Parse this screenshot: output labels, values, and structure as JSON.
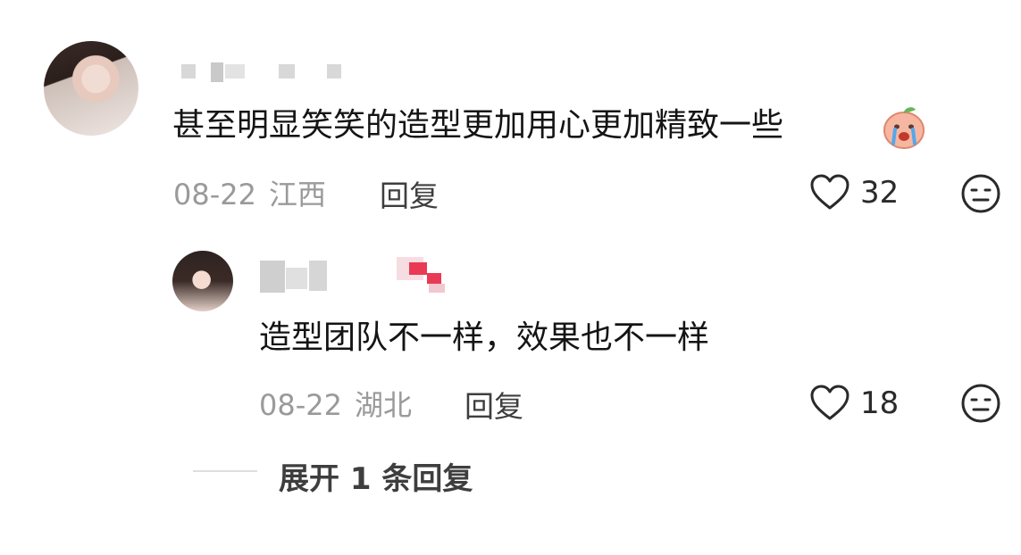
{
  "comment": {
    "text": "甚至明显笑笑的造型更加用心更加精致一些",
    "emoji_icon": "crying-peach-sticker",
    "date": "08-22",
    "location": "江西",
    "reply_label": "回复",
    "like_count": "32"
  },
  "reply": {
    "text": "造型团队不一样，效果也不一样",
    "date": "08-22",
    "location": "湖北",
    "reply_label": "回复",
    "like_count": "18"
  },
  "expand_replies": {
    "label": "展开 1 条回复"
  },
  "icons": {
    "like": "heart-outline-icon",
    "dislike": "neutral-face-icon"
  }
}
